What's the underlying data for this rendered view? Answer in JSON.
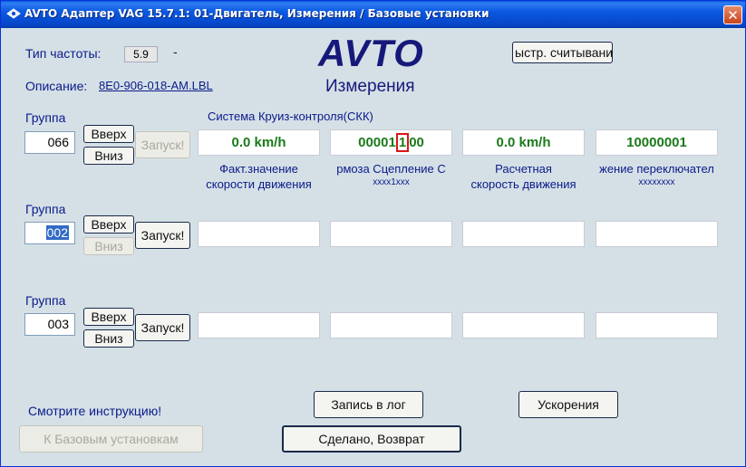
{
  "window": {
    "title": "AVTO Адаптер VAG 15.7.1: 01-Двигатель,  Измерения / Базовые установки",
    "close_label": "✕"
  },
  "header": {
    "freq_label": "Тип частоты:",
    "freq_value": "5.9",
    "freq_dash": "-",
    "desc_label": "Описание:",
    "desc_link": "8E0-906-018-AM.LBL",
    "brand": "AVTO",
    "subtitle": "Измерения",
    "fast_read_button": "ыстр. считывани"
  },
  "groups": [
    {
      "label": "Группа",
      "number": "066",
      "up": "Вверх",
      "down": "Вниз",
      "start": "Запуск!",
      "system": "Система Круиз-контроля(СКК)",
      "fields": [
        {
          "value": "0.0 km/h",
          "desc1": "Факт.значение",
          "desc2": "скорости движения",
          "desc3": ""
        },
        {
          "value_pre": "00001",
          "value_hl": "1",
          "value_post": "00",
          "desc1": "рмоза Сцепление С",
          "desc2": "xxxx1xxx",
          "desc3": ""
        },
        {
          "value": "0.0 km/h",
          "desc1": "Расчетная",
          "desc2": "скорость движения",
          "desc3": ""
        },
        {
          "value": "10000001",
          "desc1": "жение переключател",
          "desc2": "",
          "desc3": "xxxxxxxx"
        }
      ]
    },
    {
      "label": "Группа",
      "number": "002",
      "up": "Вверх",
      "down": "Вниз",
      "start": "Запуск!"
    },
    {
      "label": "Группа",
      "number": "003",
      "up": "Вверх",
      "down": "Вниз",
      "start": "Запуск!"
    }
  ],
  "footer": {
    "instructions": "Смотрите инструкцию!",
    "basic_settings": "К Базовым установкам",
    "log": "Запись в лог",
    "acceleration": "Ускорения",
    "done": "Сделано, Возврат"
  }
}
